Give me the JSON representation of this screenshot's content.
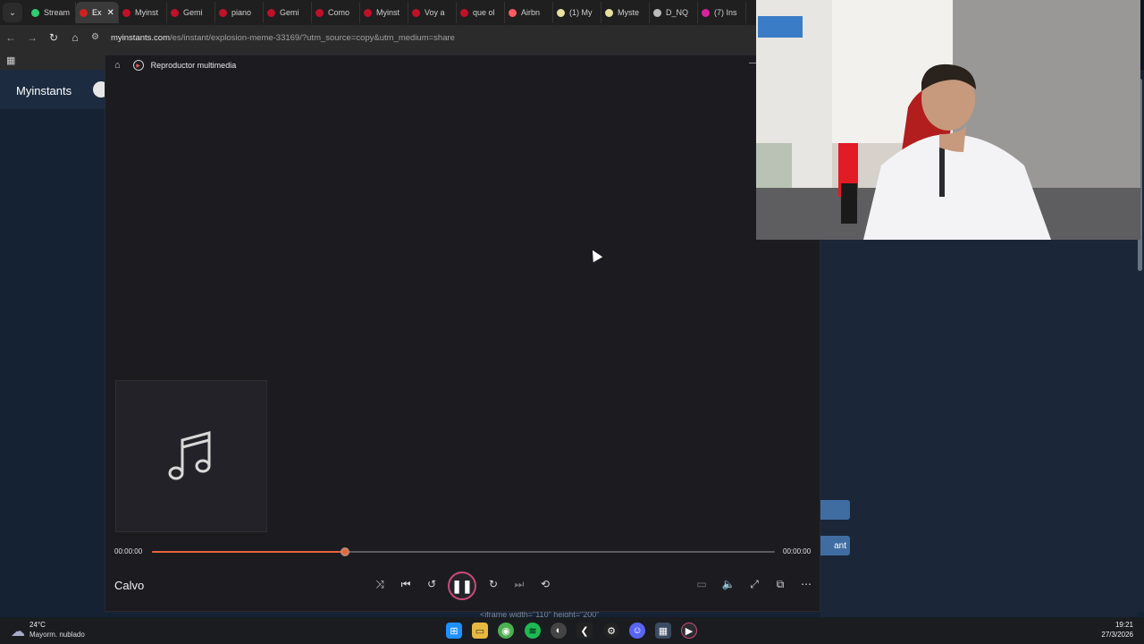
{
  "browser": {
    "tabs": [
      {
        "label": "Stream",
        "color": "#2ecc71"
      },
      {
        "label": "Ex",
        "color": "#d02020",
        "active": true
      },
      {
        "label": "Myinst",
        "color": "#c0102a"
      },
      {
        "label": "Gemi",
        "color": "#c0102a"
      },
      {
        "label": "piano",
        "color": "#c0102a"
      },
      {
        "label": "Gemi",
        "color": "#c0102a"
      },
      {
        "label": "Como",
        "color": "#c0102a"
      },
      {
        "label": "Myinst",
        "color": "#c0102a"
      },
      {
        "label": "Voy a",
        "color": "#c0102a"
      },
      {
        "label": "que ol",
        "color": "#c0102a"
      },
      {
        "label": "Airbn",
        "color": "#ff5a5f"
      },
      {
        "label": "(1) My",
        "color": "#e8e0a0"
      },
      {
        "label": "Myste",
        "color": "#e8e0a0"
      },
      {
        "label": "D_NQ",
        "color": "#bbbbbb"
      },
      {
        "label": "(7) Ins",
        "color": "#d6249f"
      }
    ],
    "url_host": "myinstants.com",
    "url_path": "/es/instant/explosion-meme-33169/?utm_source=copy&utm_medium=share"
  },
  "site": {
    "brand": "Myinstants",
    "button2_label": "ant",
    "code_peek": "<iframe width=\"110\" height=\"200\""
  },
  "player": {
    "window_title": "Reproductor multimedia",
    "song_title": "Calvo",
    "time_current": "00:00:00",
    "time_total": "00:00:00",
    "progress": 0.31,
    "accent": "#e8643c"
  },
  "taskbar": {
    "weather_temp": "24°C",
    "weather_desc": "Mayorm. nublado",
    "time": "19:21",
    "date": "27/3/2026"
  }
}
